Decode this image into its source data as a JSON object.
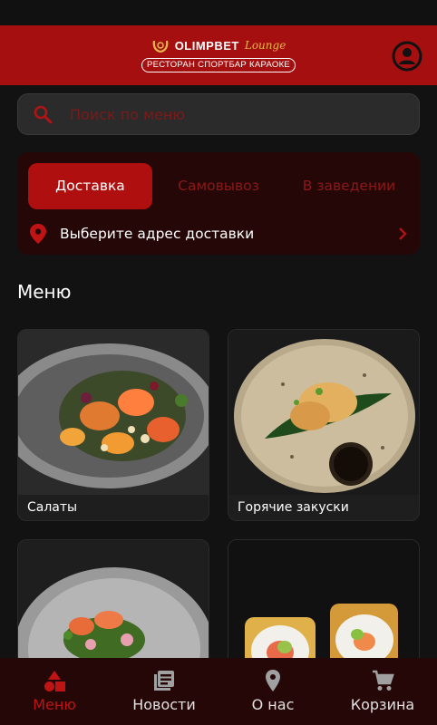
{
  "header": {
    "logo_name": "OLIMPBET",
    "logo_script": "Lounge",
    "logo_subtitle": "РЕСТОРАН СПОРТБАР КАРАОКЕ"
  },
  "search": {
    "placeholder": "Поиск по меню"
  },
  "delivery": {
    "tabs": [
      {
        "label": "Доставка",
        "active": true
      },
      {
        "label": "Самовывоз",
        "active": false
      },
      {
        "label": "В заведении",
        "active": false
      }
    ],
    "address_prompt": "Выберите адрес доставки"
  },
  "menu": {
    "title": "Меню",
    "categories": [
      {
        "label": "Салаты"
      },
      {
        "label": "Горячие закуски"
      },
      {
        "label": ""
      },
      {
        "label": ""
      }
    ]
  },
  "bottom_nav": {
    "items": [
      {
        "label": "Меню",
        "icon": "shapes-icon",
        "active": true
      },
      {
        "label": "Новости",
        "icon": "news-icon",
        "active": false
      },
      {
        "label": "О нас",
        "icon": "location-pin-icon",
        "active": false
      },
      {
        "label": "Корзина",
        "icon": "cart-icon",
        "active": false
      }
    ]
  },
  "colors": {
    "accent": "#a50f0f",
    "inactive_tab_text": "#8c1818",
    "background": "#121212",
    "panel": "#260707"
  }
}
